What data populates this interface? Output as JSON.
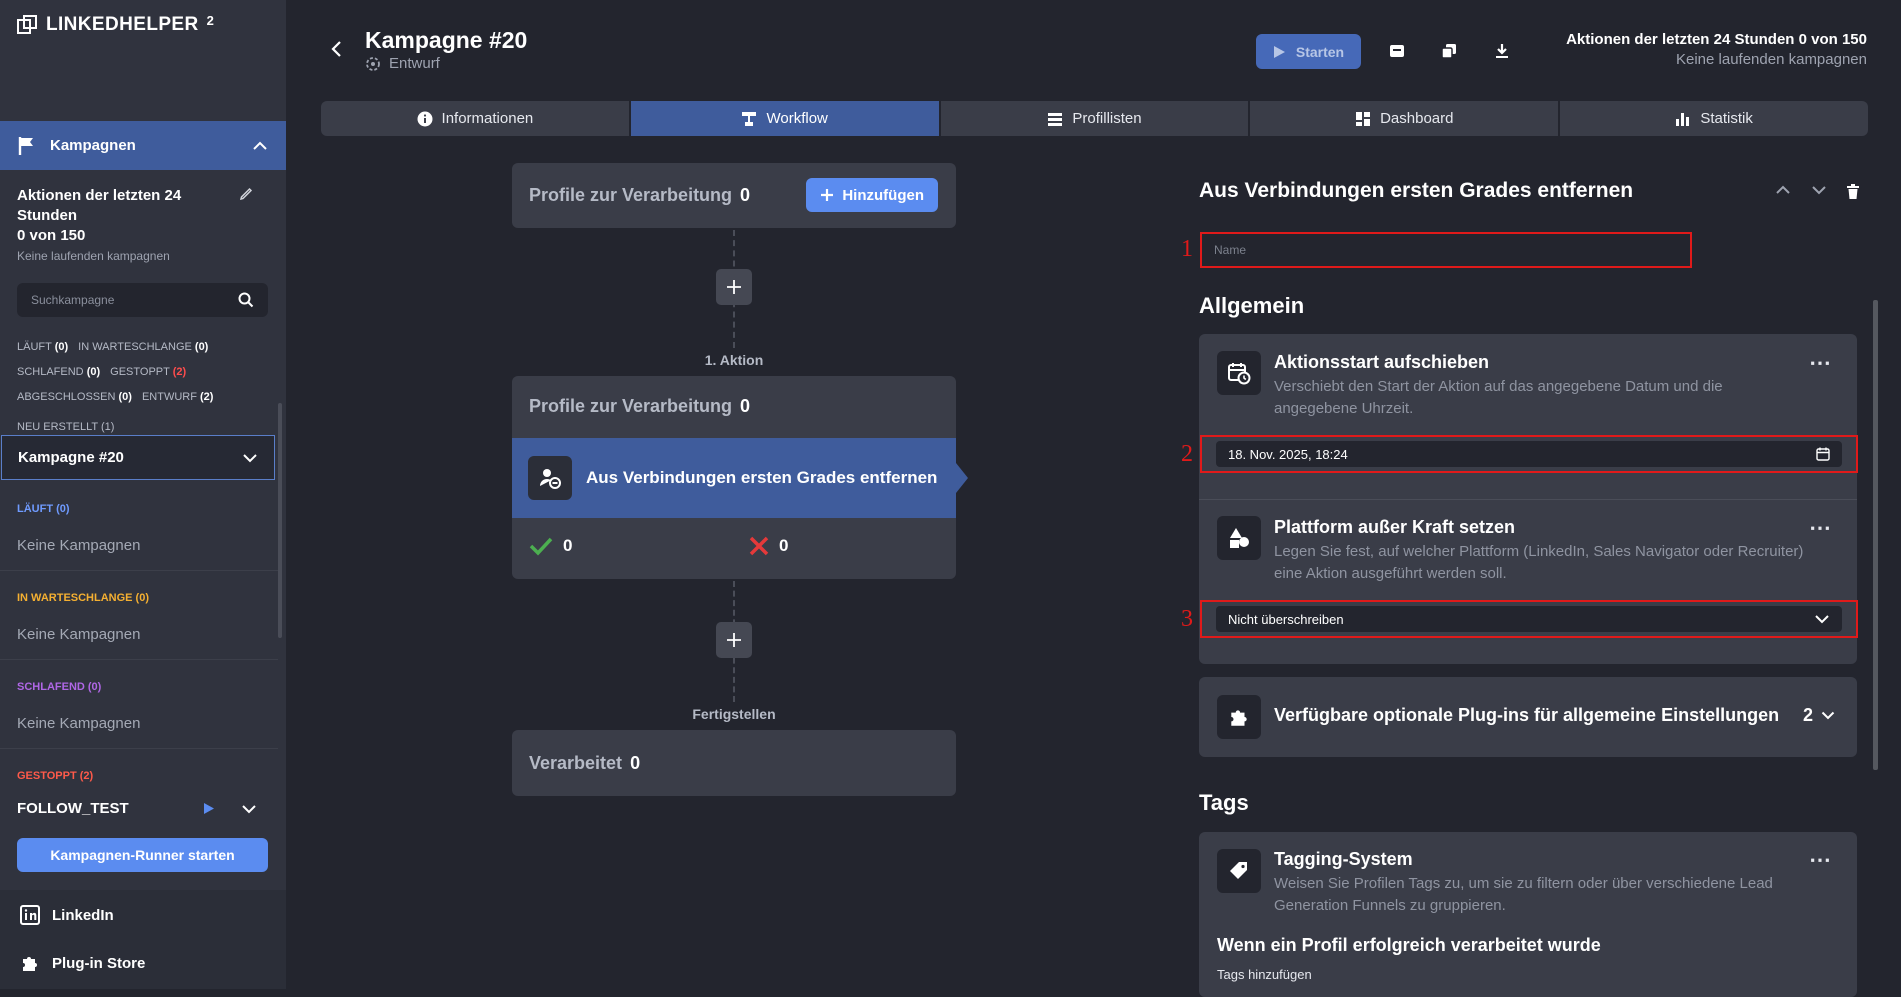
{
  "sidebar": {
    "logo_text": "LINKEDHELPER",
    "logo_sup": "2",
    "campaigns_label": "Kampagnen",
    "stats_title": "Aktionen der letzten 24 Stunden",
    "stats_value": "0 von 150",
    "stats_sub": "Keine laufenden kampagnen",
    "search_placeholder": "Suchkampagne",
    "filters": {
      "running_label": "LÄUFT",
      "running_count": "(0)",
      "queued_label": "IN WARTESCHLANGE",
      "queued_count": "(0)",
      "sleeping_label": "SCHLAFEND",
      "sleeping_count": "(0)",
      "stopped_label": "GESTOPPT",
      "stopped_count": "(2)",
      "done_label": "ABGESCHLOSSEN",
      "done_count": "(0)",
      "draft_label": "ENTWURF",
      "draft_count": "(2)",
      "new_label": "NEU ERSTELLT",
      "new_count": "(1)"
    },
    "selected_campaign": "Kampagne #20",
    "sections": [
      {
        "label": "LÄUFT (0)",
        "color": "#6f9bff",
        "empty": "Keine Kampagnen"
      },
      {
        "label": "IN WARTESCHLANGE (0)",
        "color": "#f5b031",
        "empty": "Keine Kampagnen"
      },
      {
        "label": "SCHLAFEND (0)",
        "color": "#b067e6",
        "empty": "Keine Kampagnen"
      },
      {
        "label": "GESTOPPT (2)",
        "color": "#ff5a4a",
        "empty": ""
      }
    ],
    "follow_item": "FOLLOW_TEST",
    "runner_button": "Kampagnen-Runner starten",
    "linkedin": "LinkedIn",
    "plugin_store": "Plug-in Store"
  },
  "header": {
    "title": "Kampagne #20",
    "status": "Entwurf",
    "start_button": "Starten",
    "actions_line1": "Aktionen der letzten 24 Stunden 0 von 150",
    "actions_line2": "Keine laufenden kampagnen"
  },
  "tabs": [
    {
      "label": "Informationen",
      "icon": "info-icon"
    },
    {
      "label": "Workflow",
      "icon": "workflow-icon",
      "active": true
    },
    {
      "label": "Profillisten",
      "icon": "list-icon"
    },
    {
      "label": "Dashboard",
      "icon": "dashboard-icon"
    },
    {
      "label": "Statistik",
      "icon": "bar-chart-icon"
    }
  ],
  "workflow": {
    "top_card_label": "Profile zur Verarbeitung",
    "top_card_count": "0",
    "add_button": "Hinzufügen",
    "action_label": "1. Aktion",
    "action_card_label": "Profile zur Verarbeitung",
    "action_card_count": "0",
    "step_title": "Aus Verbindungen ersten Grades entfernen",
    "success_count": "0",
    "fail_count": "0",
    "finish_label": "Fertigstellen",
    "processed_label": "Verarbeitet",
    "processed_count": "0"
  },
  "panel": {
    "title": "Aus Verbindungen ersten Grades entfernen",
    "name_placeholder": "Name",
    "general_title": "Allgemein",
    "delay": {
      "title": "Aktionsstart aufschieben",
      "desc": "Verschiebt den Start der Aktion auf das angegebene Datum und die angegebene Uhrzeit.",
      "value": "18. Nov. 2025, 18:24"
    },
    "platform": {
      "title": "Plattform außer Kraft setzen",
      "desc": "Legen Sie fest, auf welcher Plattform (LinkedIn, Sales Navigator oder Recruiter) eine Aktion ausgeführt werden soll.",
      "value": "Nicht überschreiben"
    },
    "plugins": {
      "title": "Verfügbare optionale Plug-ins für allgemeine Einstellungen",
      "count": "2"
    },
    "tags_title": "Tags",
    "tagging": {
      "title": "Tagging-System",
      "desc": "Weisen Sie Profilen Tags zu, um sie zu filtern oder über verschiedene Lead Generation Funnels zu gruppieren.",
      "success_heading": "Wenn ein Profil erfolgreich verarbeitet wurde",
      "add_tags": "Tags hinzufügen"
    }
  },
  "annotations": [
    "1",
    "2",
    "3"
  ],
  "colors": {
    "accent": "#5b8cf0",
    "active_tab": "#3f5c9c",
    "annotation": "#e01a1a"
  }
}
